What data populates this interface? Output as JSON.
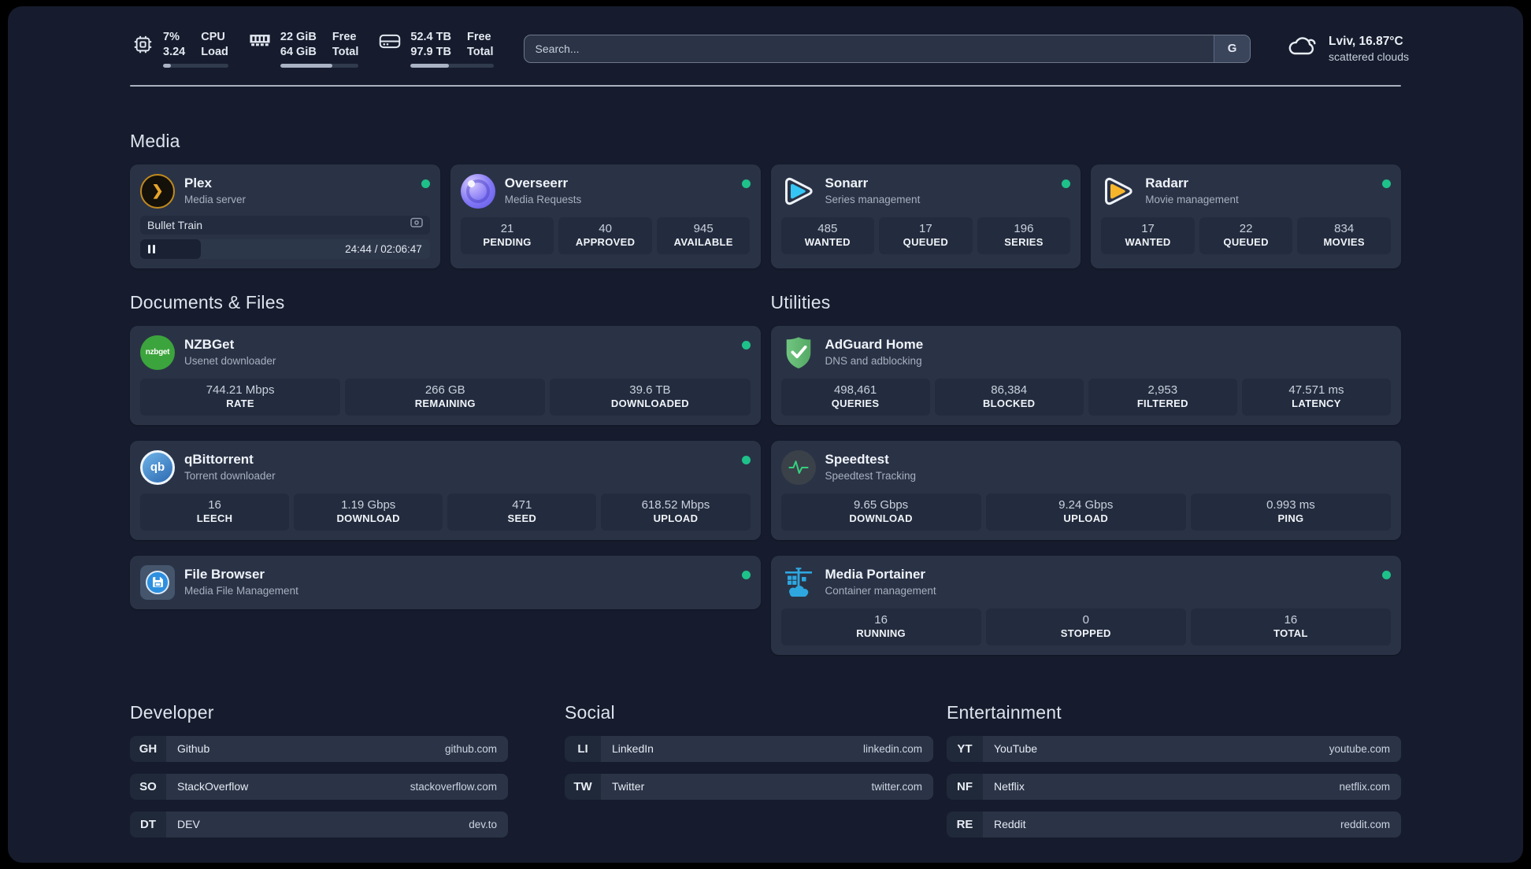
{
  "system": {
    "cpu": {
      "line1_value": "7%",
      "line2_value": "3.24",
      "line1_label": "CPU",
      "line2_label": "Load",
      "bar_fill": "12%"
    },
    "memory": {
      "line1_value": "22 GiB",
      "line2_value": "64 GiB",
      "line1_label": "Free",
      "line2_label": "Total",
      "bar_fill": "66%"
    },
    "storage": {
      "line1_value": "52.4 TB",
      "line2_value": "97.9 TB",
      "line1_label": "Free",
      "line2_label": "Total",
      "bar_fill": "46%"
    }
  },
  "search": {
    "placeholder": "Search...",
    "provider_button": "G"
  },
  "weather": {
    "location_temp": "Lviv, 16.87°C",
    "condition": "scattered clouds"
  },
  "sections": {
    "media": "Media",
    "documents": "Documents & Files",
    "utilities": "Utilities",
    "developer": "Developer",
    "social": "Social",
    "entertainment": "Entertainment"
  },
  "logo_texts": {
    "plex": "❯",
    "nzbget": "nzbget",
    "qbittorrent": "qb"
  },
  "apps": {
    "plex": {
      "name": "Plex",
      "description": "Media server",
      "online": true,
      "player": {
        "title": "Bullet Train",
        "time": "24:44 / 02:06:47",
        "progress_fill": "21%",
        "state": "paused"
      }
    },
    "overseerr": {
      "name": "Overseerr",
      "description": "Media Requests",
      "online": true,
      "stats": [
        {
          "value": "21",
          "label": "PENDING"
        },
        {
          "value": "40",
          "label": "APPROVED"
        },
        {
          "value": "945",
          "label": "AVAILABLE"
        }
      ]
    },
    "sonarr": {
      "name": "Sonarr",
      "description": "Series management",
      "online": true,
      "stats": [
        {
          "value": "485",
          "label": "WANTED"
        },
        {
          "value": "17",
          "label": "QUEUED"
        },
        {
          "value": "196",
          "label": "SERIES"
        }
      ]
    },
    "radarr": {
      "name": "Radarr",
      "description": "Movie management",
      "online": true,
      "stats": [
        {
          "value": "17",
          "label": "WANTED"
        },
        {
          "value": "22",
          "label": "QUEUED"
        },
        {
          "value": "834",
          "label": "MOVIES"
        }
      ]
    },
    "nzbget": {
      "name": "NZBGet",
      "description": "Usenet downloader",
      "online": true,
      "stats": [
        {
          "value": "744.21 Mbps",
          "label": "RATE"
        },
        {
          "value": "266 GB",
          "label": "REMAINING"
        },
        {
          "value": "39.6 TB",
          "label": "DOWNLOADED"
        }
      ]
    },
    "qbittorrent": {
      "name": "qBittorrent",
      "description": "Torrent downloader",
      "online": true,
      "stats": [
        {
          "value": "16",
          "label": "LEECH"
        },
        {
          "value": "1.19 Gbps",
          "label": "DOWNLOAD"
        },
        {
          "value": "471",
          "label": "SEED"
        },
        {
          "value": "618.52 Mbps",
          "label": "UPLOAD"
        }
      ]
    },
    "filebrowser": {
      "name": "File Browser",
      "description": "Media File Management",
      "online": true
    },
    "adguard": {
      "name": "AdGuard Home",
      "description": "DNS and adblocking",
      "stats": [
        {
          "value": "498,461",
          "label": "QUERIES"
        },
        {
          "value": "86,384",
          "label": "BLOCKED"
        },
        {
          "value": "2,953",
          "label": "FILTERED"
        },
        {
          "value": "47.571 ms",
          "label": "LATENCY"
        }
      ]
    },
    "speedtest": {
      "name": "Speedtest",
      "description": "Speedtest Tracking",
      "stats": [
        {
          "value": "9.65 Gbps",
          "label": "DOWNLOAD"
        },
        {
          "value": "9.24 Gbps",
          "label": "UPLOAD"
        },
        {
          "value": "0.993 ms",
          "label": "PING"
        }
      ]
    },
    "portainer": {
      "name": "Media Portainer",
      "description": "Container management",
      "online": true,
      "stats": [
        {
          "value": "16",
          "label": "RUNNING"
        },
        {
          "value": "0",
          "label": "STOPPED"
        },
        {
          "value": "16",
          "label": "TOTAL"
        }
      ]
    }
  },
  "bookmarks": {
    "developer": [
      {
        "abbr": "GH",
        "name": "Github",
        "url": "github.com"
      },
      {
        "abbr": "SO",
        "name": "StackOverflow",
        "url": "stackoverflow.com"
      },
      {
        "abbr": "DT",
        "name": "DEV",
        "url": "dev.to"
      }
    ],
    "social": [
      {
        "abbr": "LI",
        "name": "LinkedIn",
        "url": "linkedin.com"
      },
      {
        "abbr": "TW",
        "name": "Twitter",
        "url": "twitter.com"
      }
    ],
    "entertainment": [
      {
        "abbr": "YT",
        "name": "YouTube",
        "url": "youtube.com"
      },
      {
        "abbr": "NF",
        "name": "Netflix",
        "url": "netflix.com"
      },
      {
        "abbr": "RE",
        "name": "Reddit",
        "url": "reddit.com"
      }
    ]
  },
  "colors": {
    "status_online": "#1ec189",
    "plex_amber": "#e7a52a",
    "sonarr_blue": "#35c5f4",
    "radarr_yellow": "#f7b52c",
    "adguard_green": "#5fba6f",
    "nzbget_green": "#3ca43c",
    "qbittorrent_blue": "#2c6ab2",
    "portainer_blue": "#2ea7e0",
    "speedtest_pulse": "#35d07f"
  }
}
